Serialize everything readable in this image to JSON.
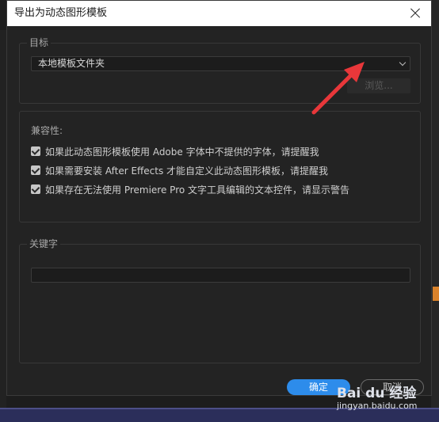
{
  "dialog": {
    "title": "导出为动态图形模板",
    "close_icon": "close-icon"
  },
  "target": {
    "label": "目标",
    "selected": "本地模板文件夹",
    "browse_label": "浏览..."
  },
  "compat": {
    "title": "兼容性:",
    "items": [
      "如果此动态图形模板使用 Adobe 字体中不提供的字体，请提醒我",
      "如果需要安装 After Effects 才能自定义此动态图形模板，请提醒我",
      "如果存在无法使用 Premiere Pro 文字工具编辑的文本控件，请显示警告"
    ]
  },
  "keywords": {
    "label": "关键字",
    "value": ""
  },
  "footer": {
    "ok_label": "确定",
    "cancel_label": "取消"
  },
  "watermark": {
    "logo": "Bai du 经验",
    "url": "jingyan.baidu.com"
  },
  "colors": {
    "accent": "#2d8ceb",
    "annotation_arrow": "#e8373a"
  }
}
